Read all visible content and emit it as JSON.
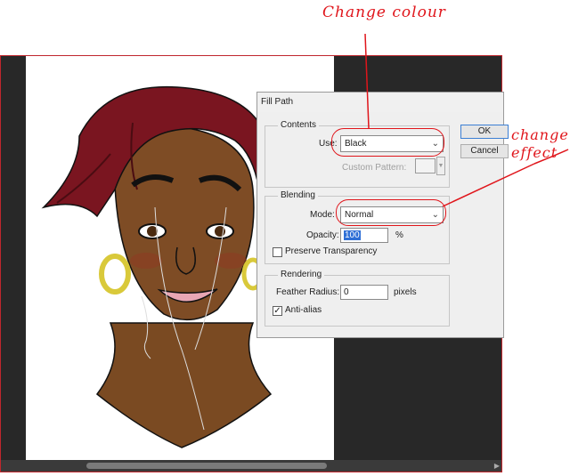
{
  "annotations": {
    "change_colour": "Change colour",
    "change_effect": "change effect"
  },
  "dialog": {
    "title": "Fill Path",
    "contents": {
      "label": "Contents",
      "use_label": "Use:",
      "use_value": "Black",
      "custom_pattern_label": "Custom Pattern:"
    },
    "blending": {
      "label": "Blending",
      "mode_label": "Mode:",
      "mode_value": "Normal",
      "opacity_label": "Opacity:",
      "opacity_value": "100",
      "opacity_unit": "%",
      "preserve_transparency_label": "Preserve Transparency",
      "preserve_transparency_checked": false
    },
    "rendering": {
      "label": "Rendering",
      "feather_label": "Feather Radius:",
      "feather_value": "0",
      "feather_unit": "pixels",
      "anti_alias_label": "Anti-alias",
      "anti_alias_checked": true
    },
    "ok_label": "OK",
    "cancel_label": "Cancel"
  },
  "colors": {
    "annotation": "#e0151b",
    "hair": "#7a1520",
    "skin": "#7a4a22",
    "earring": "#d9c93a",
    "workspace": "#282828"
  }
}
